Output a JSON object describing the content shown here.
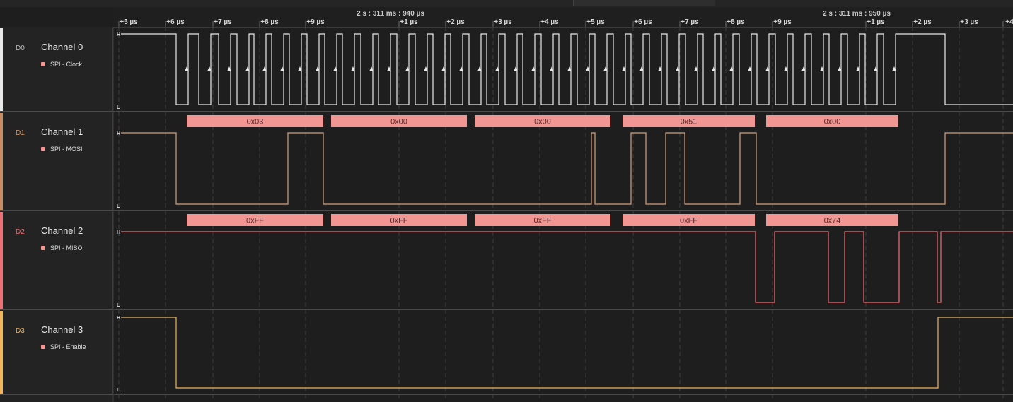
{
  "colors": {
    "clock": "#e8e8e8",
    "mosi": "#d4a07c",
    "miso": "#ee6f74",
    "enable": "#f3b45c",
    "bubble": "#f29694"
  },
  "timeline": {
    "absolute_labels": [
      "2 s : 311 ms : 940 µs",
      "2 s : 311 ms : 950 µs"
    ],
    "ticks": [
      "+5 µs",
      "+6 µs",
      "+7 µs",
      "+8 µs",
      "+9 µs",
      "+1 µs",
      "+2 µs",
      "+3 µs",
      "+4 µs",
      "+5 µs",
      "+6 µs",
      "+7 µs",
      "+8 µs",
      "+9 µs",
      "+1 µs",
      "+2 µs",
      "+3 µs",
      "+4"
    ]
  },
  "channels": [
    {
      "id": "D0",
      "name": "Channel 0",
      "analyzer": "SPI - Clock",
      "color": "#e8e8e8",
      "id_color": "#bdbdbd"
    },
    {
      "id": "D1",
      "name": "Channel 1",
      "analyzer": "SPI - MOSI",
      "color": "#c98b62",
      "id_color": "#d29a6f"
    },
    {
      "id": "D2",
      "name": "Channel 2",
      "analyzer": "SPI - MISO",
      "color": "#ee6f74",
      "id_color": "#ee6f74"
    },
    {
      "id": "D3",
      "name": "Channel 3",
      "analyzer": "SPI - Enable",
      "color": "#f3b45c",
      "id_color": "#f3b45c"
    }
  ],
  "level_labels": {
    "high": "H",
    "low": "L"
  },
  "decoded": {
    "mosi": [
      "0x03",
      "0x00",
      "0x00",
      "0x51",
      "0x00"
    ],
    "miso": [
      "0xFF",
      "0xFF",
      "0xFF",
      "0xFF",
      "0x74"
    ]
  }
}
